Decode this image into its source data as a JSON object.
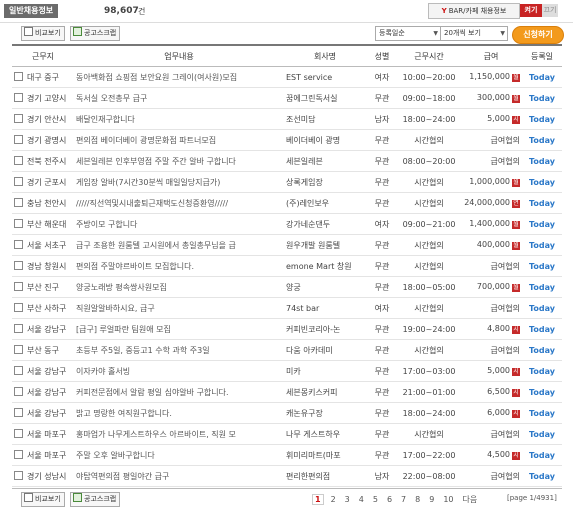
{
  "header": {
    "tab_label": "일반채용정보",
    "total_count": "98,607",
    "total_unit": "건",
    "bar_info": "BAR/카페 채용정보",
    "bar_info_logo": "Y",
    "toggle_on": "켜기",
    "toggle_off": "끄기"
  },
  "toolbar": {
    "compare_label": "비교보기",
    "scrap_label": "공고스크랩",
    "sort_value": "등록일순",
    "per_page_value": "20개씩 보기",
    "apply_label": "신청하기"
  },
  "columns": [
    "근무지",
    "업무내용",
    "회사명",
    "성별",
    "근무시간",
    "급여",
    "등록일"
  ],
  "rows": [
    {
      "loc": "대구 중구",
      "job": "동아백화점 쇼핑점 보안요원 그레이(여사원)모집",
      "company": "EST service",
      "gender": "여자",
      "time": "10:00~20:00",
      "pay": "1,150,000",
      "pay_type": "월",
      "date": "Today"
    },
    {
      "loc": "경기 고양시",
      "job": "독서실 오전총무 급구",
      "company": "꿈에그린독서실",
      "gender": "무관",
      "time": "09:00~18:00",
      "pay": "300,000",
      "pay_type": "월",
      "date": "Today"
    },
    {
      "loc": "경기 안산시",
      "job": "배달인재구합니다",
      "company": "조선미담",
      "gender": "남자",
      "time": "18:00~24:00",
      "pay": "5,000",
      "pay_type": "시",
      "date": "Today"
    },
    {
      "loc": "경기 광명시",
      "job": "편의점 베이더베이 광명문화점 파트너모집",
      "company": "베이더베이 광명",
      "gender": "무관",
      "time": "시간협의",
      "pay": "급여협의",
      "pay_type": "",
      "date": "Today"
    },
    {
      "loc": "전북 전주시",
      "job": "세븐일레븐 인후부영점 주말 주간 알바 구합니다",
      "company": "세븐일레븐",
      "gender": "무관",
      "time": "08:00~20:00",
      "pay": "급여협의",
      "pay_type": "",
      "date": "Today"
    },
    {
      "loc": "경기 군포시",
      "job": "게임장 알바(7시간30분씩 매일일당지급가)",
      "company": "상록게임장",
      "gender": "무관",
      "time": "시간협의",
      "pay": "1,000,000",
      "pay_type": "월",
      "date": "Today"
    },
    {
      "loc": "충남 천안시",
      "job": "/////직선역및시내출퇴근재택도신청증환영/////",
      "company": "(주)레인보우",
      "gender": "무관",
      "time": "시간협의",
      "pay": "24,000,000",
      "pay_type": "연",
      "date": "Today"
    },
    {
      "loc": "부산 해운대",
      "job": "주방이모 구합니다",
      "company": "강가네순댄두",
      "gender": "여자",
      "time": "09:00~21:00",
      "pay": "1,400,000",
      "pay_type": "월",
      "date": "Today"
    },
    {
      "loc": "서울 서초구",
      "job": "급구 조용한 원룸텔 고시원에서 총일총무님을 급",
      "company": "원우개발 원룸텔",
      "gender": "무관",
      "time": "시간협의",
      "pay": "400,000",
      "pay_type": "월",
      "date": "Today"
    },
    {
      "loc": "경남 창원시",
      "job": "편의점 주말야르바이트 모집합니다.",
      "company": "emone Mart 창원",
      "gender": "무관",
      "time": "시간협의",
      "pay": "급여협의",
      "pay_type": "",
      "date": "Today"
    },
    {
      "loc": "부산 진구",
      "job": "양궁노래방 평속쌍사원모집",
      "company": "양궁",
      "gender": "무관",
      "time": "18:00~05:00",
      "pay": "700,000",
      "pay_type": "월",
      "date": "Today"
    },
    {
      "loc": "부산 사하구",
      "job": "직원알알바하시요, 급구",
      "company": "74st bar",
      "gender": "여자",
      "time": "시간협의",
      "pay": "급여협의",
      "pay_type": "",
      "date": "Today"
    },
    {
      "loc": "서울 강남구",
      "job": "[급구] 루얼파란 팀원애 모집",
      "company": "커피빈코리아-논",
      "gender": "무관",
      "time": "19:00~24:00",
      "pay": "4,800",
      "pay_type": "시",
      "date": "Today"
    },
    {
      "loc": "부산 동구",
      "job": "초등부 주5일, 중등고1 수학 과학 주3일",
      "company": "다움 아카데미",
      "gender": "무관",
      "time": "시간협의",
      "pay": "급여협의",
      "pay_type": "",
      "date": "Today"
    },
    {
      "loc": "서울 강남구",
      "job": "이자카야 홀서빙",
      "company": "미카",
      "gender": "무관",
      "time": "17:00~03:00",
      "pay": "5,000",
      "pay_type": "시",
      "date": "Today"
    },
    {
      "loc": "서울 강남구",
      "job": "커피전문점에서 알람 평일 심야알바 구합니다.",
      "company": "세븐몽키스커피",
      "gender": "무관",
      "time": "21:00~01:00",
      "pay": "6,500",
      "pay_type": "시",
      "date": "Today"
    },
    {
      "loc": "서울 강남구",
      "job": "밝고 명랑한 여직원구합니다.",
      "company": "캐논유구장",
      "gender": "무관",
      "time": "18:00~24:00",
      "pay": "6,000",
      "pay_type": "시",
      "date": "Today"
    },
    {
      "loc": "서울 마포구",
      "job": "홍마업가 나무게스트하우스 아르바이트, 직원 모",
      "company": "나무 게스트하우",
      "gender": "무관",
      "time": "시간협의",
      "pay": "급여협의",
      "pay_type": "",
      "date": "Today"
    },
    {
      "loc": "서울 마포구",
      "job": "주말 오후 알바구합니다",
      "company": "휘미리마트(마포",
      "gender": "무관",
      "time": "17:00~22:00",
      "pay": "4,500",
      "pay_type": "시",
      "date": "Today"
    },
    {
      "loc": "경기 성남시",
      "job": "야탑역편의점 평일야간 급구",
      "company": "편리한편의점",
      "gender": "남자",
      "time": "22:00~08:00",
      "pay": "급여협의",
      "pay_type": "",
      "date": "Today"
    }
  ],
  "pager": {
    "pages": [
      "1",
      "2",
      "3",
      "4",
      "5",
      "6",
      "7",
      "8",
      "9",
      "10"
    ],
    "current": "1",
    "next_label": "다음",
    "page_info": "[page 1/4931]"
  },
  "colors": {
    "accent_orange": "#f39a1c",
    "today_blue": "#2b78c8",
    "pay_red": "#c52a2a"
  }
}
